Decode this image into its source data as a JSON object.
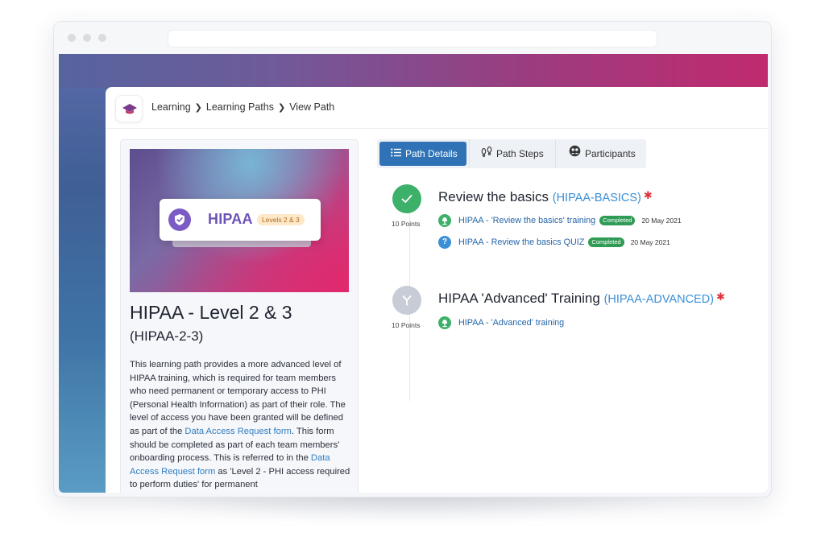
{
  "breadcrumb": [
    "Learning",
    "Learning Paths",
    "View Path"
  ],
  "tabs": [
    {
      "label": "Path Details",
      "icon": "list-icon",
      "active": true
    },
    {
      "label": "Path Steps",
      "icon": "footsteps-icon",
      "active": false
    },
    {
      "label": "Participants",
      "icon": "people-icon",
      "active": false
    }
  ],
  "path": {
    "badge_name": "HIPAA",
    "badge_level": "Levels 2 & 3",
    "title": "HIPAA - Level 2 & 3",
    "code": "(HIPAA-2-3)",
    "description": {
      "p1": "This learning path provides a more advanced level of HIPAA training, which is required for team members who need permanent or temporary access to PHI (Personal Health Information) as part of their role. The level of access you have been granted will be defined as part of the ",
      "link1": "Data Access Request form",
      "p2": ". This form should be completed as part of each team members' onboarding process. This is referred to in the ",
      "link2": "Data Access Request form",
      "p3": " as 'Level 2 - PHI access required to perform duties' for permanent"
    }
  },
  "steps": [
    {
      "title": "Review the basics",
      "code": "(HIPAA-BASICS)",
      "required_mark": "✱",
      "points": "10 Points",
      "status": "completed",
      "items": [
        {
          "label": "HIPAA - 'Review the basics' training",
          "type": "training",
          "status": "Completed",
          "date": "20 May 2021"
        },
        {
          "label": "HIPAA - Review the basics QUIZ",
          "type": "quiz",
          "status": "Completed",
          "date": "20 May 2021"
        }
      ]
    },
    {
      "title": "HIPAA 'Advanced' Training",
      "code": "(HIPAA-ADVANCED)",
      "required_mark": "✱",
      "points": "10 Points",
      "status": "branch",
      "items": [
        {
          "label": "HIPAA - 'Advanced' training",
          "type": "training"
        }
      ]
    }
  ],
  "colors": {
    "accent": "#2f73b6",
    "link": "#2566a8",
    "completed_green": "#3db06a",
    "pending_grey": "#c7ccd6",
    "badge_purple": "#7a5cc4",
    "required_red": "#e0323c"
  }
}
